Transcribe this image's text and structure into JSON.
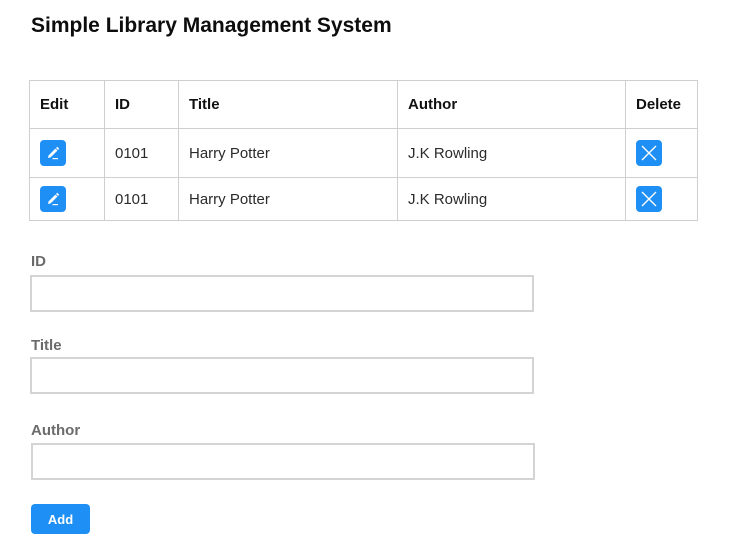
{
  "page": {
    "title": "Simple Library Management System"
  },
  "table": {
    "headers": {
      "edit": "Edit",
      "id": "ID",
      "title": "Title",
      "author": "Author",
      "delete": "Delete"
    },
    "rows": [
      {
        "id": "0101",
        "title": "Harry Potter",
        "author": "J.K Rowling",
        "edit_icon": "edit-pencil-icon",
        "delete_icon": "close-x-icon"
      },
      {
        "id": "0101",
        "title": "Harry Potter",
        "author": "J.K Rowling",
        "edit_icon": "edit-pencil-icon",
        "delete_icon": "close-x-icon"
      }
    ]
  },
  "form": {
    "id_label": "ID",
    "id_value": "",
    "title_label": "Title",
    "title_value": "",
    "author_label": "Author",
    "author_value": "",
    "add_label": "Add"
  },
  "colors": {
    "accent": "#1e8ff5",
    "border": "#cfcfcf",
    "label": "#6b6b6b"
  }
}
